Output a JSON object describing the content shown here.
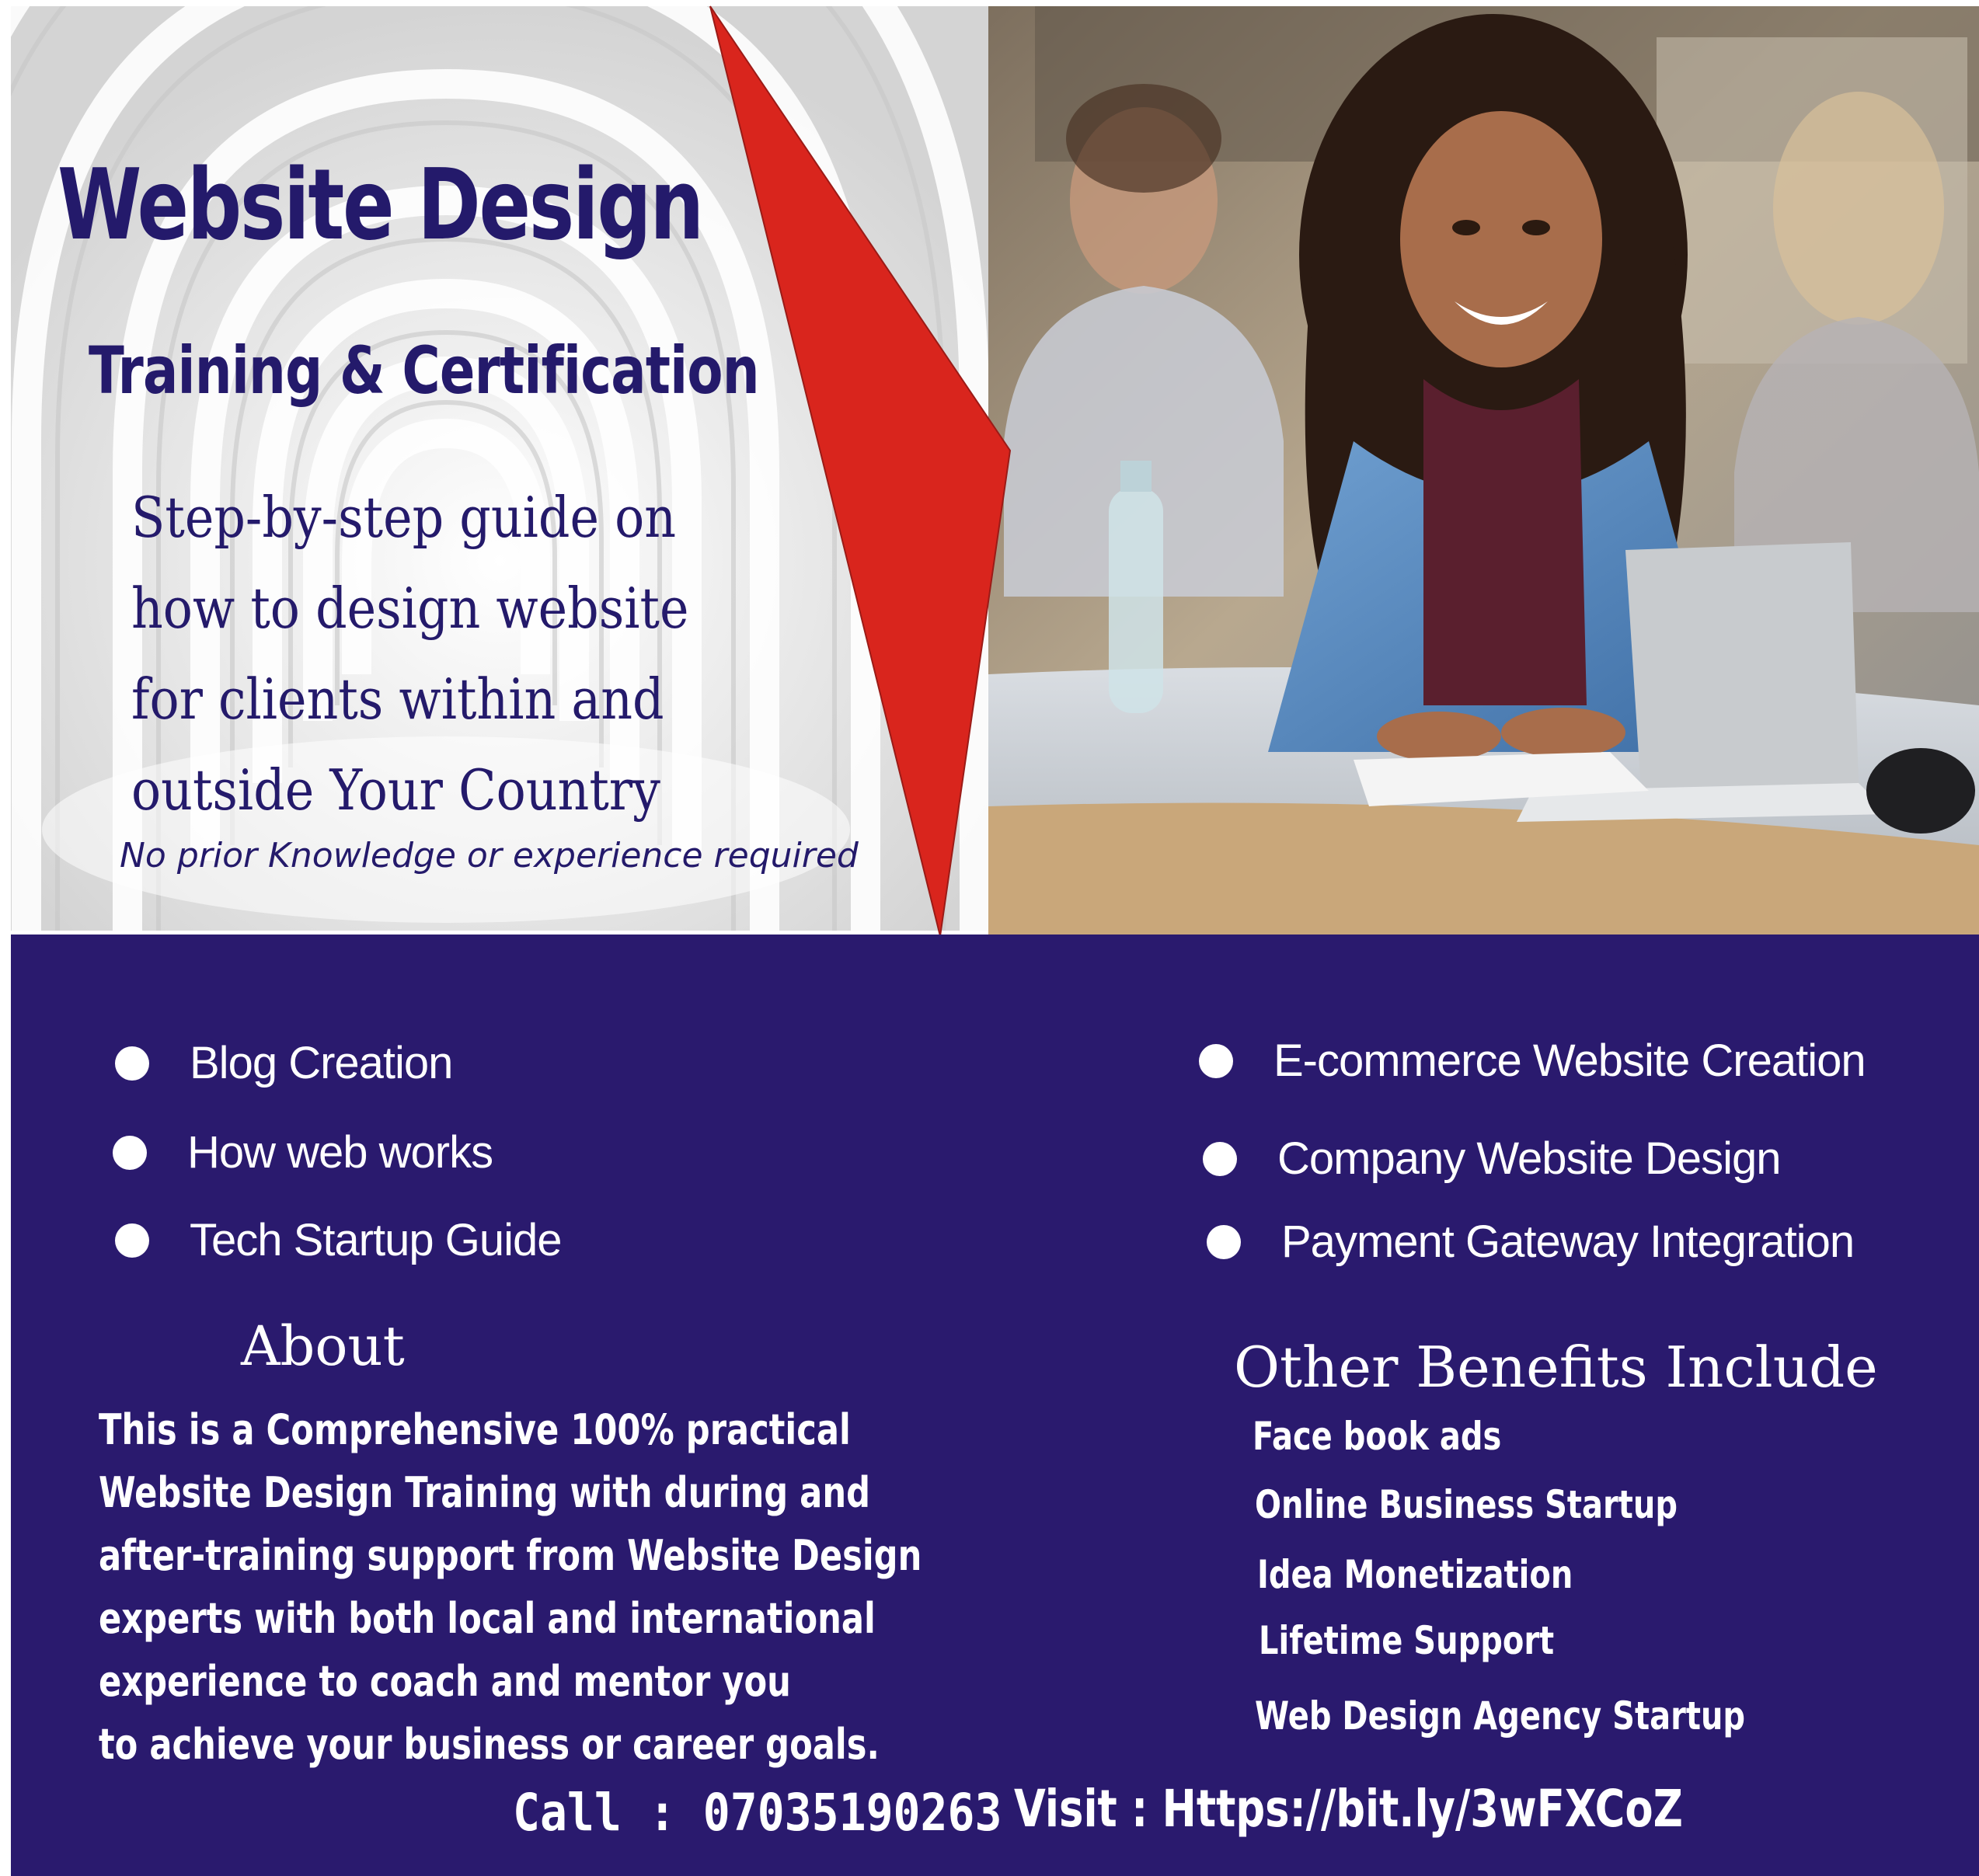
{
  "hero": {
    "title": "Website Design",
    "subtitle": "Training & Certification",
    "guide_lines": [
      "Step-by-step guide on",
      "how to design website",
      "for clients within and",
      "outside Your Country"
    ],
    "note": "No prior Knowledge or experience required"
  },
  "topics": {
    "left": [
      "Blog Creation",
      "How web works",
      "Tech Startup Guide"
    ],
    "right": [
      "E-commerce Website Creation",
      "Company Website Design",
      "Payment  Gateway Integration"
    ]
  },
  "about": {
    "heading": "About",
    "lines": [
      "This is a Comprehensive 100% practical",
      "Website Design Training with during and",
      "after-training support from Website Design",
      "experts with both local and international",
      "experience to coach and mentor you",
      "to achieve your business or career goals."
    ]
  },
  "benefits": {
    "heading": "Other Benefits Include",
    "items": [
      "Face book ads",
      "Online Business Startup",
      "Idea Monetization",
      "Lifetime Support",
      "Web Design Agency Startup"
    ]
  },
  "contact": {
    "call": "Call : 07035190263",
    "visit": "Visit : Https://bit.ly/3wFXCoZ"
  },
  "colors": {
    "navy": "#2a1a6e",
    "heading_text": "#241a6b",
    "accent_red": "#d9251d",
    "white": "#ffffff"
  }
}
